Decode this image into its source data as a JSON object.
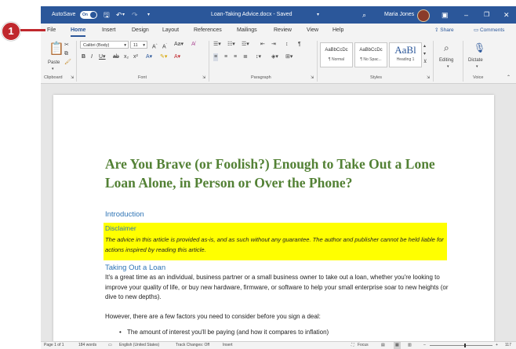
{
  "titlebar": {
    "autosave_label": "AutoSave",
    "autosave_state": "On",
    "document_title": "Loan-Taking Advice.docx - Saved",
    "user_name": "Maria Jones"
  },
  "tabs": [
    "File",
    "Home",
    "Insert",
    "Design",
    "Layout",
    "References",
    "Mailings",
    "Review",
    "View",
    "Help"
  ],
  "ribbon_buttons": {
    "share": "Share",
    "comments": "Comments"
  },
  "ribbon": {
    "paste_label": "Paste",
    "font_name": "Calibri (Body)",
    "font_size": "11",
    "styles": [
      {
        "preview": "AaBbCcDc",
        "name": "¶ Normal"
      },
      {
        "preview": "AaBbCcDc",
        "name": "¶ No Spac..."
      },
      {
        "preview": "AaBl",
        "name": "Heading 1"
      }
    ],
    "editing_label": "Editing",
    "dictate_label": "Dictate",
    "groups": [
      "Clipboard",
      "Font",
      "Paragraph",
      "Styles",
      "Voice"
    ]
  },
  "document": {
    "title": "Are You Brave (or Foolish?) Enough to Take Out a Lone Loan Alone, in Person or Over the Phone?",
    "introduction_heading": "Introduction",
    "disclaimer_heading": "Disclaimer",
    "disclaimer_text": "The advice in this article is provided as-is, and as such without any guarantee. The author and publisher cannot be held liable for actions inspired by reading this article.",
    "section_heading": "Taking Out a Loan",
    "paragraph1": "It's a great time as an individual, business partner or a small business owner to take out a loan, whether you're looking to improve your quality of life, or buy new  hardware, firmware, or software to help your small enterprise soar to new heights (or dive to new depths).",
    "paragraph2": "However, there are a few factors you need to consider before you sign a deal:",
    "bullet1": "The amount of interest you'll be paying (and how it compares to inflation)"
  },
  "statusbar": {
    "page": "Page 1 of 1",
    "words": "184 words",
    "language": "English (United States)",
    "track_changes": "Track Changes: Off",
    "insert": "Insert",
    "focus": "Focus",
    "zoom": "117"
  },
  "step_badge": "1",
  "colors": {
    "word_blue": "#2b579a",
    "title_green": "#538135",
    "heading_blue": "#2e74b5",
    "highlight": "#ffff00",
    "badge_red": "#c0282d"
  }
}
